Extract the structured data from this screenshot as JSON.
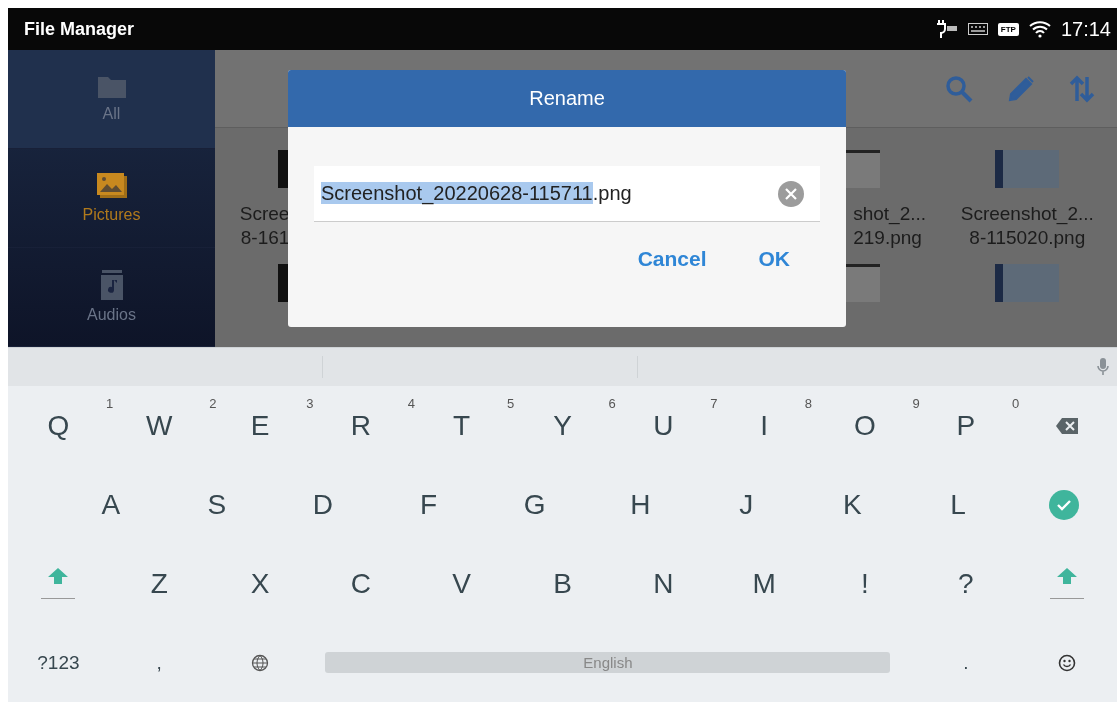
{
  "status_bar": {
    "app_title": "File Manager",
    "ftp_badge": "FTP",
    "time": "17:14"
  },
  "sidebar": {
    "items": [
      {
        "label": "All",
        "selected": false
      },
      {
        "label": "Pictures",
        "selected": true
      },
      {
        "label": "Audios",
        "selected": false
      }
    ]
  },
  "files": [
    {
      "name": "Scree",
      "name_line_2": "8-161"
    },
    {
      "name": "shot_2...",
      "name_line_2": "219.png"
    },
    {
      "name": "Screenshot_2...",
      "name_line_2": "8-115020.png"
    }
  ],
  "dialog": {
    "title": "Rename",
    "value_parts": [
      {
        "text": "Screenshot_20220628-115711",
        "selected": true
      },
      {
        "text": ".png",
        "selected": false
      }
    ],
    "buttons": [
      "Cancel",
      "OK"
    ]
  },
  "keyboard": {
    "rows": [
      [
        {
          "kind": "letter",
          "label": "Q",
          "hint": "1"
        },
        {
          "kind": "letter",
          "label": "W",
          "hint": "2"
        },
        {
          "kind": "letter",
          "label": "E",
          "hint": "3"
        },
        {
          "kind": "letter",
          "label": "R",
          "hint": "4"
        },
        {
          "kind": "letter",
          "label": "T",
          "hint": "5"
        },
        {
          "kind": "letter",
          "label": "Y",
          "hint": "6"
        },
        {
          "kind": "letter",
          "label": "U",
          "hint": "7"
        },
        {
          "kind": "letter",
          "label": "I",
          "hint": "8"
        },
        {
          "kind": "letter",
          "label": "O",
          "hint": "9"
        },
        {
          "kind": "letter",
          "label": "P",
          "hint": "0"
        },
        {
          "kind": "backspace"
        }
      ],
      [
        {
          "kind": "letter",
          "label": "A"
        },
        {
          "kind": "letter",
          "label": "S"
        },
        {
          "kind": "letter",
          "label": "D"
        },
        {
          "kind": "letter",
          "label": "F"
        },
        {
          "kind": "letter",
          "label": "G"
        },
        {
          "kind": "letter",
          "label": "H"
        },
        {
          "kind": "letter",
          "label": "J"
        },
        {
          "kind": "letter",
          "label": "K"
        },
        {
          "kind": "letter",
          "label": "L"
        },
        {
          "kind": "enter"
        }
      ],
      [
        {
          "kind": "shift"
        },
        {
          "kind": "letter",
          "label": "Z"
        },
        {
          "kind": "letter",
          "label": "X"
        },
        {
          "kind": "letter",
          "label": "C"
        },
        {
          "kind": "letter",
          "label": "V"
        },
        {
          "kind": "letter",
          "label": "B"
        },
        {
          "kind": "letter",
          "label": "N"
        },
        {
          "kind": "letter",
          "label": "M"
        },
        {
          "kind": "letter",
          "label": "!"
        },
        {
          "kind": "letter",
          "label": "?"
        },
        {
          "kind": "shift"
        }
      ]
    ],
    "bottom_row": [
      {
        "kind": "text",
        "label": "?123"
      },
      {
        "kind": "text",
        "label": ","
      },
      {
        "kind": "globe"
      },
      {
        "kind": "space",
        "label": "English"
      },
      {
        "kind": "text",
        "label": "."
      },
      {
        "kind": "emoji"
      }
    ]
  }
}
